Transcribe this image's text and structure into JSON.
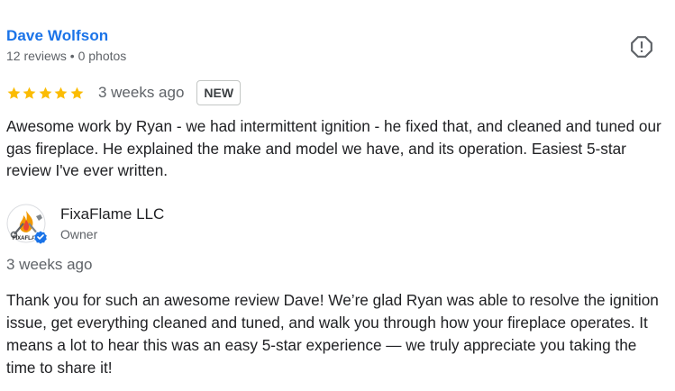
{
  "review": {
    "reviewer_name": "Dave Wolfson",
    "reviewer_meta": "12 reviews • 0 photos",
    "report_icon": "report-flag-icon",
    "rating": 5,
    "rating_max": 5,
    "date": "3 weeks ago",
    "badge": "NEW",
    "text": "Awesome work by Ryan - we had intermittent ignition - he fixed that, and cleaned and tuned our gas fireplace. He explained the make and model we have, and its operation. Easiest 5-star review I've ever written."
  },
  "owner_reply": {
    "name": "FixaFlame LLC",
    "role": "Owner",
    "avatar_text": "FIXAFLAM",
    "verified_icon": "verified-check-icon",
    "date": "3 weeks ago",
    "text": "Thank you for such an awesome review Dave! We’re glad Ryan was able to resolve the ignition issue, get everything cleaned and tuned, and walk you through how your fireplace operates. It means a lot to hear this was an easy 5-star experience — we truly appreciate you taking the time to share it!"
  },
  "colors": {
    "link_blue": "#1a73e8",
    "star_gold": "#fbbc04",
    "muted_text": "#5f6368",
    "verified_blue": "#1a73e8"
  }
}
